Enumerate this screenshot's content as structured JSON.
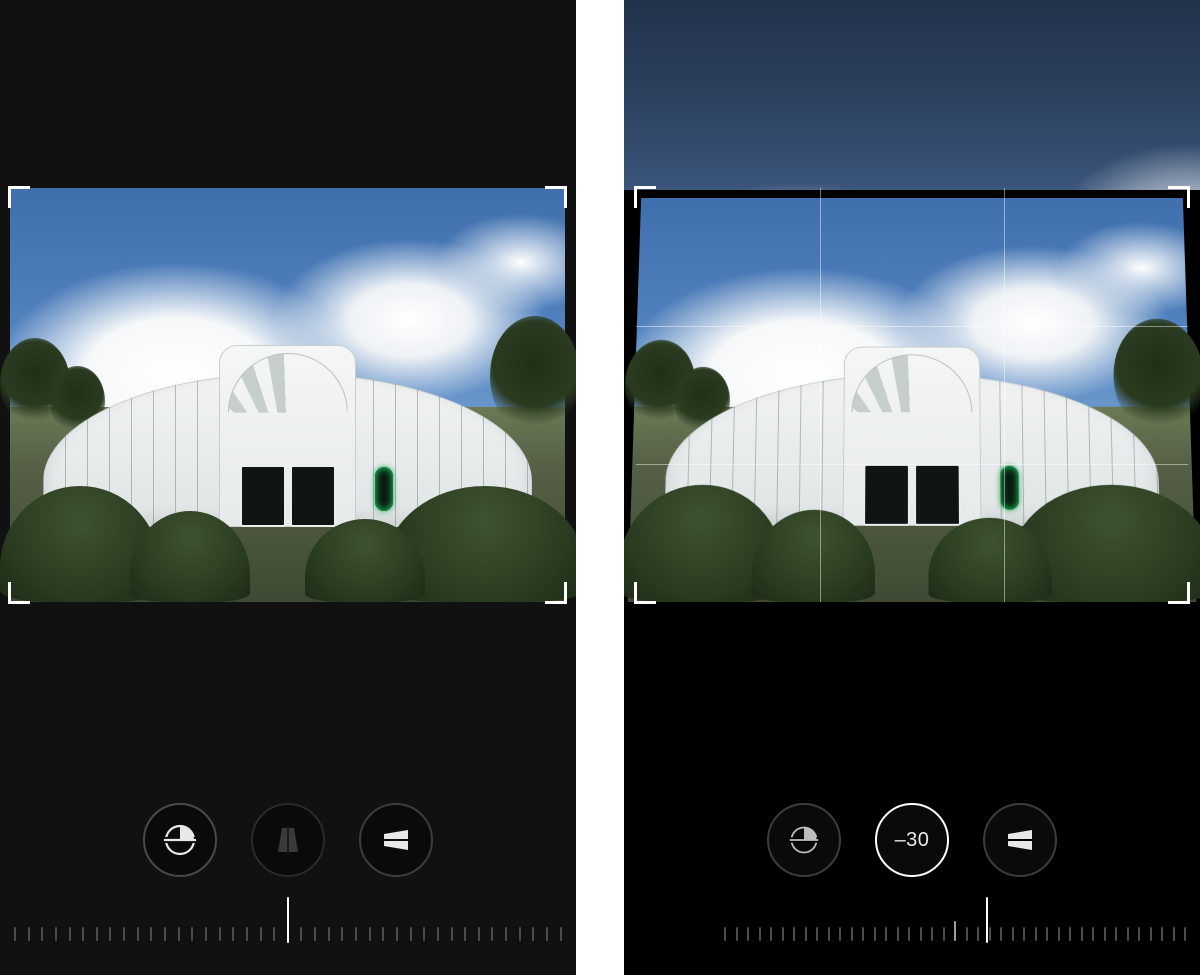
{
  "left": {
    "tools": {
      "straighten": {
        "name": "straighten",
        "selected": true
      },
      "vertical": {
        "name": "vertical-perspective",
        "selected": false,
        "value": ""
      },
      "horizontal": {
        "name": "horizontal-perspective",
        "selected": false
      }
    },
    "dial": {
      "tick_count": 41,
      "indicator_position_pct": 50
    }
  },
  "right": {
    "tools": {
      "straighten": {
        "name": "straighten",
        "selected": false
      },
      "vertical": {
        "name": "vertical-perspective",
        "selected": true,
        "value": "–30"
      },
      "horizontal": {
        "name": "horizontal-perspective",
        "selected": false
      }
    },
    "dial": {
      "tick_count": 41,
      "indicator_position_pct": 57
    }
  },
  "grid": {
    "show_on_right": true,
    "show_on_left": false
  }
}
